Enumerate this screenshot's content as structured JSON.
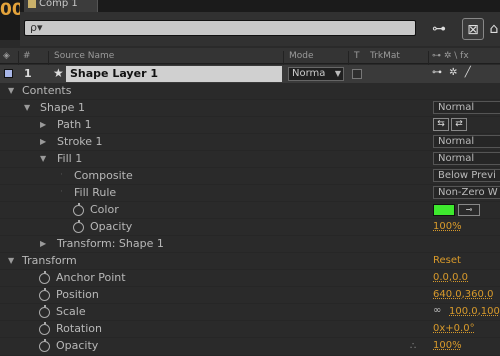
{
  "header": {
    "timecode_fragment": "00",
    "tab_title": "Comp 1",
    "search_placeholder": "ρ▾"
  },
  "columns": {
    "number": "#",
    "source_name": "Source Name",
    "mode": "Mode",
    "t": "T",
    "trkmat": "TrkMat",
    "switches": "⊶ ✲ \\ fx"
  },
  "layer": {
    "number": "1",
    "name": "Shape Layer 1",
    "mode": "Norma",
    "label_color": "#a9b7e8"
  },
  "properties": [
    {
      "label": "Contents",
      "value": ""
    },
    {
      "label": "Shape 1",
      "mode": "Normal"
    },
    {
      "label": "Path 1",
      "value": ""
    },
    {
      "label": "Stroke 1",
      "mode": "Normal"
    },
    {
      "label": "Fill 1",
      "mode": "Normal"
    },
    {
      "label": "Composite",
      "mode": "Below Previ"
    },
    {
      "label": "Fill Rule",
      "mode": "Non-Zero W"
    },
    {
      "label": "Color",
      "value": "",
      "swatch": "#3ee82e"
    },
    {
      "label": "Opacity",
      "value": "100%"
    },
    {
      "label": "Transform: Shape 1",
      "value": ""
    },
    {
      "label": "Transform",
      "value": "Reset"
    },
    {
      "label": "Anchor Point",
      "value": "0.0,0.0"
    },
    {
      "label": "Position",
      "value": "640.0,360.0"
    },
    {
      "label": "Scale",
      "value": "100.0,100"
    },
    {
      "label": "Rotation",
      "value": "0x+0.0°"
    },
    {
      "label": "Opacity",
      "value": "100%"
    }
  ],
  "icons": {
    "search": "search-icon",
    "star": "star-icon",
    "stopwatch": "stopwatch-icon",
    "link": "chain-link-icon"
  },
  "colors": {
    "value_orange": "#d89a2b",
    "fill_green": "#3ee82e"
  }
}
